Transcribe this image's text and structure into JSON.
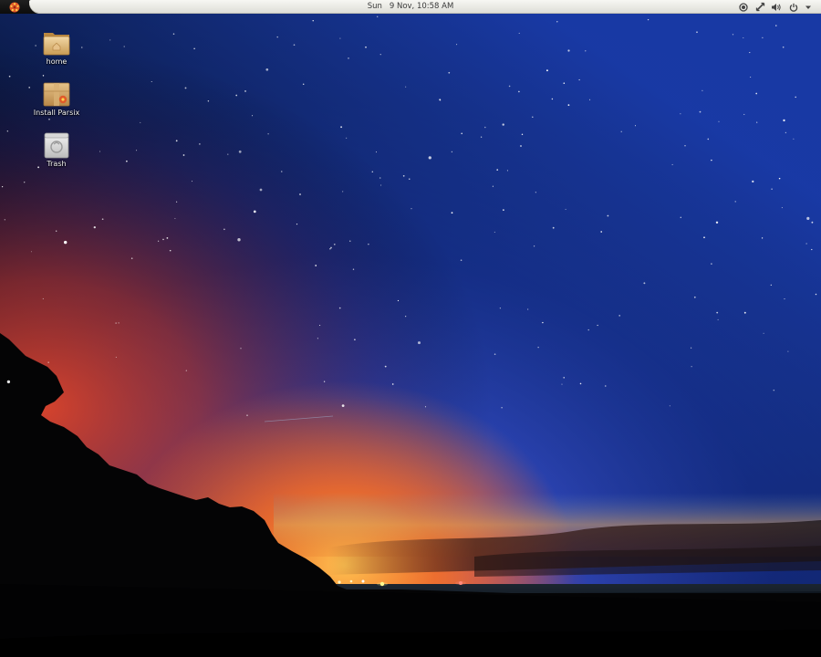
{
  "panel": {
    "clock_day": "Sun",
    "clock_datetime": "9 Nov, 10:58 AM",
    "tray_icons": [
      "record-icon",
      "network-icon",
      "volume-icon",
      "power-icon",
      "dropdown-arrow-icon"
    ]
  },
  "desktop": {
    "icons": [
      {
        "label": "home",
        "icon": "folder-icon"
      },
      {
        "label": "Install Parsix",
        "icon": "package-icon"
      },
      {
        "label": "Trash",
        "icon": "trash-icon"
      }
    ]
  },
  "colors": {
    "panel_bar": "#f0f0ec",
    "panel_text": "#3a3a3a",
    "activities_accent": "#e05a2a",
    "sky_top": "#03050d",
    "sky_blue": "#1f3ba3",
    "sunset_orange": "#f26a1e",
    "sunset_red": "#c4382a"
  }
}
